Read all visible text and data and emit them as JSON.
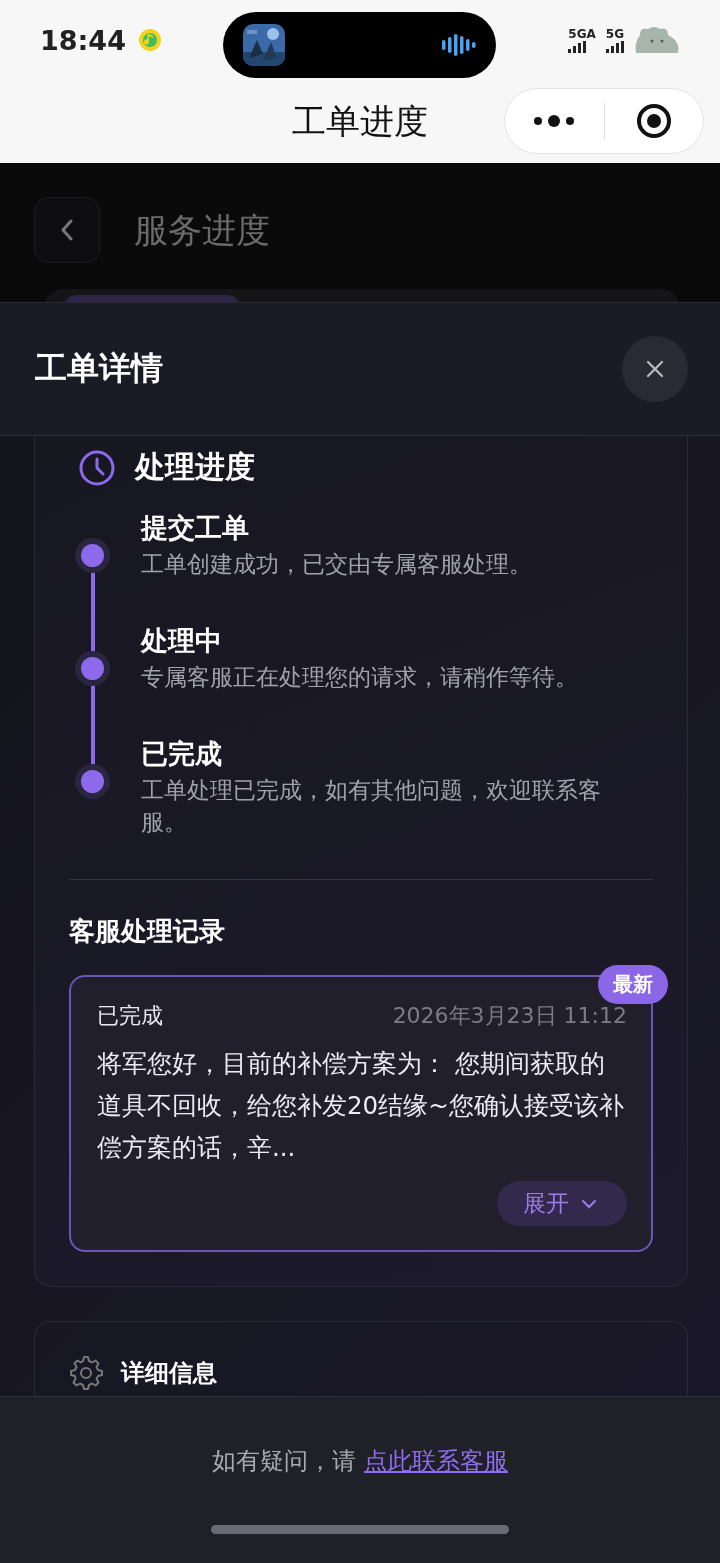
{
  "status_bar": {
    "time": "18:44",
    "network_1": "5GA",
    "network_2": "5G"
  },
  "nav_bar": {
    "title": "工单进度"
  },
  "background_page": {
    "title": "服务进度"
  },
  "sheet": {
    "title": "工单详情"
  },
  "progress": {
    "title": "处理进度",
    "steps": [
      {
        "title": "提交工单",
        "description": "工单创建成功，已交由专属客服处理。"
      },
      {
        "title": "处理中",
        "description": "专属客服正在处理您的请求，请稍作等待。"
      },
      {
        "title": "已完成",
        "description": "工单处理已完成，如有其他问题，欢迎联系客服。"
      }
    ]
  },
  "records": {
    "title": "客服处理记录",
    "items": [
      {
        "status": "已完成",
        "time": "2026年3月23日 11:12",
        "message": "将军您好，目前的补偿方案为： 您期间获取的道具不回收，给您补发20结缘~您确认接受该补偿方案的话，辛...",
        "badge": "最新",
        "expand_label": "展开"
      }
    ]
  },
  "details": {
    "title": "详细信息"
  },
  "footer": {
    "text": "如有疑问，请",
    "link": "点此联系客服"
  }
}
